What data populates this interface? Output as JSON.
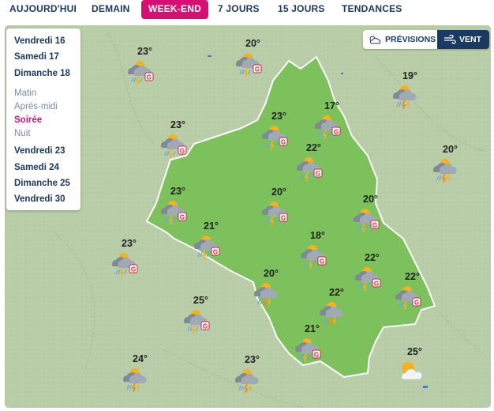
{
  "tabs": [
    {
      "label": "AUJOURD'HUI",
      "active": false
    },
    {
      "label": "DEMAIN",
      "active": false
    },
    {
      "label": "WEEK-END",
      "active": true
    },
    {
      "label": "7 JOURS",
      "active": false
    },
    {
      "label": "15 JOURS",
      "active": false
    },
    {
      "label": "TENDANCES",
      "active": false
    }
  ],
  "colors": {
    "accent": "#d80f73",
    "navy": "#1b3a63",
    "region_fill": "#7cc15c",
    "map_bg": "#b9cda8"
  },
  "view_toggle": {
    "previsions_label": "PRÉVISIONS",
    "vent_label": "VENT",
    "active": "vent",
    "previsions_icon": "cloud-sun-icon",
    "vent_icon": "wind-icon"
  },
  "day_panel": {
    "days_top": [
      "Vendredi 16",
      "Samedi 17",
      "Dimanche 18"
    ],
    "periods": [
      {
        "label": "Matin",
        "active": false
      },
      {
        "label": "Après-midi",
        "active": false
      },
      {
        "label": "Soirée",
        "active": true
      },
      {
        "label": "Nuit",
        "active": false
      }
    ],
    "days_bottom": [
      "Vendredi 23",
      "Samedi 24",
      "Dimanche 25",
      "Vendredi 30"
    ]
  },
  "markers": [
    {
      "temp": "23°",
      "icon": "storm-hail-icon"
    },
    {
      "temp": "20°",
      "icon": "storm-hail-icon"
    },
    {
      "temp": "19°",
      "icon": "sun-cloud-storm-icon"
    },
    {
      "temp": "17°",
      "icon": "storm-hail-icon"
    },
    {
      "temp": "23°",
      "icon": "storm-hail-icon"
    },
    {
      "temp": "23°",
      "icon": "storm-hail-icon"
    },
    {
      "temp": "22°",
      "icon": "storm-hail-icon"
    },
    {
      "temp": "20°",
      "icon": "sun-cloud-storm-icon"
    },
    {
      "temp": "23°",
      "icon": "storm-hail-icon"
    },
    {
      "temp": "20°",
      "icon": "storm-hail-icon"
    },
    {
      "temp": "20°",
      "icon": "storm-hail-icon"
    },
    {
      "temp": "21°",
      "icon": "storm-hail-icon"
    },
    {
      "temp": "23°",
      "icon": "storm-hail-icon"
    },
    {
      "temp": "18°",
      "icon": "storm-hail-icon"
    },
    {
      "temp": "22°",
      "icon": "storm-hail-icon"
    },
    {
      "temp": "20°",
      "icon": "sun-cloud-storm-icon"
    },
    {
      "temp": "22°",
      "icon": "storm-hail-icon"
    },
    {
      "temp": "22°",
      "icon": "sun-cloud-storm-icon"
    },
    {
      "temp": "25°",
      "icon": "storm-hail-icon"
    },
    {
      "temp": "21°",
      "icon": "storm-hail-icon"
    },
    {
      "temp": "25°",
      "icon": "sun-cloud-icon"
    },
    {
      "temp": "24°",
      "icon": "sun-cloud-storm-icon"
    },
    {
      "temp": "23°",
      "icon": "sun-cloud-storm-icon"
    }
  ]
}
